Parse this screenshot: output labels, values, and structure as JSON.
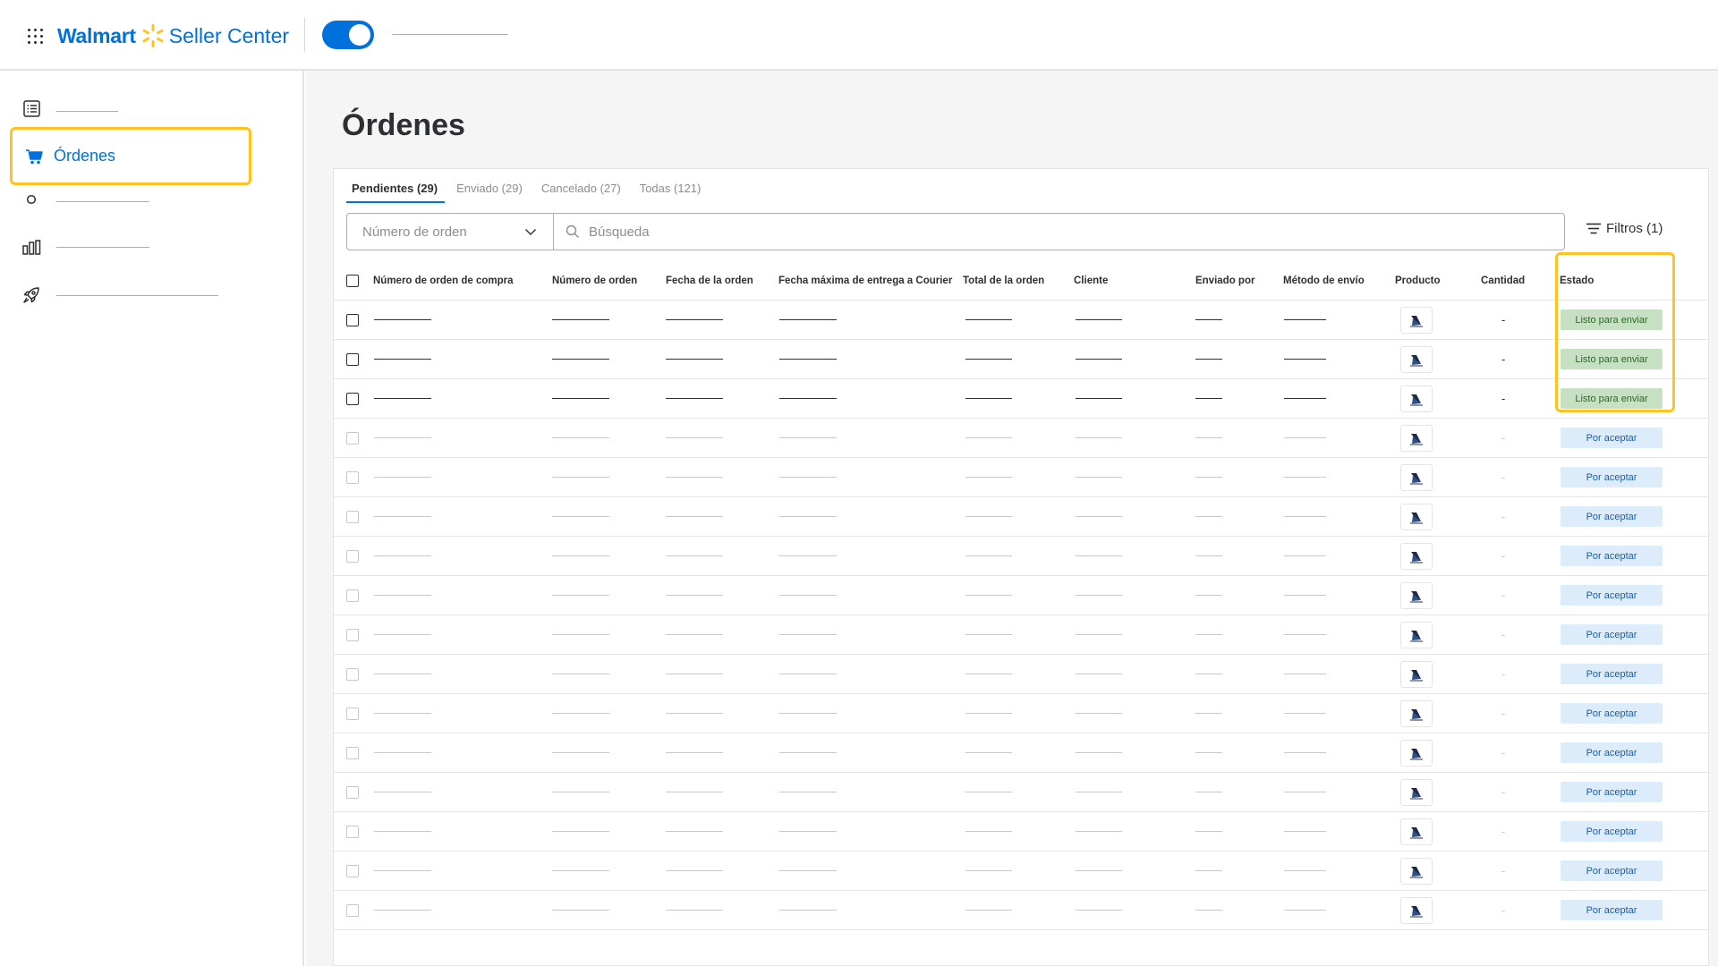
{
  "header": {
    "brand_primary": "Walmart",
    "brand_secondary": "Seller Center",
    "toggle_on": true
  },
  "sidebar": {
    "items": [
      {
        "icon": "list-icon",
        "label": ""
      },
      {
        "icon": "cart-icon",
        "label": "Órdenes",
        "active": true
      },
      {
        "icon": "circle-icon",
        "label": ""
      },
      {
        "icon": "bar-chart-icon",
        "label": ""
      },
      {
        "icon": "rocket-icon",
        "label": ""
      }
    ]
  },
  "main": {
    "title": "Órdenes",
    "tabs": [
      {
        "label": "Pendientes (29)",
        "active": true
      },
      {
        "label": "Enviado (29)"
      },
      {
        "label": "Cancelado (27)"
      },
      {
        "label": "Todas (121)"
      }
    ],
    "order_select": {
      "placeholder": "Número de orden"
    },
    "search": {
      "placeholder": "Búsqueda"
    },
    "filters_label": "Filtros (1)",
    "columns": [
      "Número de orden de compra",
      "Número de orden",
      "Fecha de la orden",
      "Fecha máxima de entrega a Courier",
      "Total de la orden",
      "Cliente",
      "Enviado por",
      "Método de envío",
      "Producto",
      "Cantidad",
      "Estado"
    ],
    "rows": [
      {
        "quantity": "-",
        "status": "Listo para enviar",
        "status_type": "ready"
      },
      {
        "quantity": "-",
        "status": "Listo para enviar",
        "status_type": "ready"
      },
      {
        "quantity": "-",
        "status": "Listo para enviar",
        "status_type": "ready"
      },
      {
        "quantity": "-",
        "status": "Por aceptar",
        "status_type": "pending"
      },
      {
        "quantity": "-",
        "status": "Por aceptar",
        "status_type": "pending"
      },
      {
        "quantity": "-",
        "status": "Por aceptar",
        "status_type": "pending"
      },
      {
        "quantity": "-",
        "status": "Por aceptar",
        "status_type": "pending"
      },
      {
        "quantity": "-",
        "status": "Por aceptar",
        "status_type": "pending"
      },
      {
        "quantity": "-",
        "status": "Por aceptar",
        "status_type": "pending"
      },
      {
        "quantity": "-",
        "status": "Por aceptar",
        "status_type": "pending"
      },
      {
        "quantity": "-",
        "status": "Por aceptar",
        "status_type": "pending"
      },
      {
        "quantity": "-",
        "status": "Por aceptar",
        "status_type": "pending"
      },
      {
        "quantity": "-",
        "status": "Por aceptar",
        "status_type": "pending"
      },
      {
        "quantity": "-",
        "status": "Por aceptar",
        "status_type": "pending"
      },
      {
        "quantity": "-",
        "status": "Por aceptar",
        "status_type": "pending"
      },
      {
        "quantity": "-",
        "status": "Por aceptar",
        "status_type": "pending"
      }
    ]
  },
  "colors": {
    "brand_blue": "#0071dc",
    "brand_yellow": "#ffc220",
    "ready_bg": "#c7dfc3",
    "pending_bg": "#dcecfa"
  }
}
